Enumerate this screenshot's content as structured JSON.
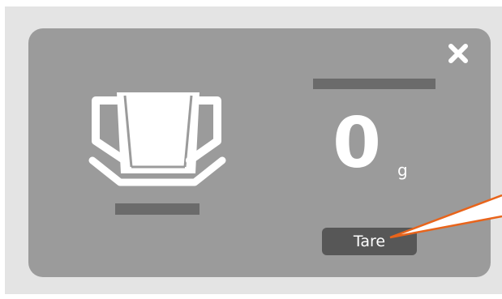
{
  "dialog": {
    "close_icon": "close-icon",
    "cup_icon": "cup-on-saucer-icon",
    "weight": {
      "value": "0",
      "unit": "g"
    },
    "tare_label": "Tare"
  },
  "colors": {
    "backdrop": "#e4e4e4",
    "panel": "#9b9b9b",
    "placeholder_bar": "#6b6b6b",
    "tare_button": "#575757",
    "callout_line": "#e8641b",
    "text": "#ffffff"
  }
}
